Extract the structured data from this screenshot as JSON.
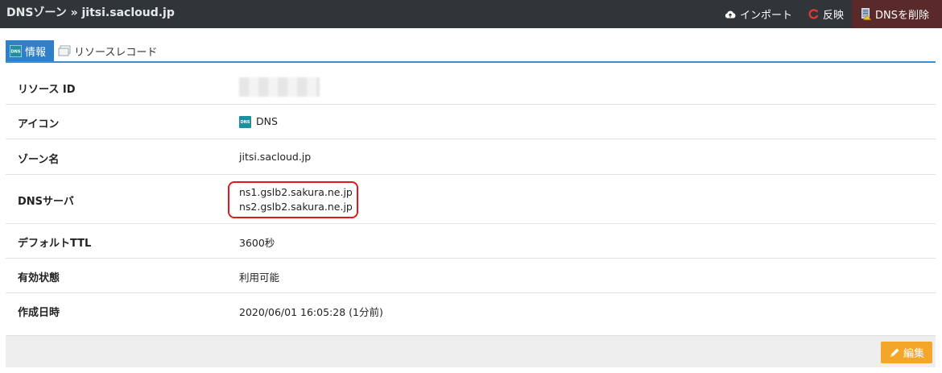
{
  "header": {
    "breadcrumb": "DNSゾーン » jitsi.sacloud.jp",
    "actions": {
      "import_label": "インポート",
      "apply_label": "反映",
      "delete_label": "DNSを削除"
    }
  },
  "tabs": [
    {
      "label": "情報",
      "active": true,
      "icon": "dns-icon"
    },
    {
      "label": "リソースレコード",
      "active": false,
      "icon": "records-icon"
    }
  ],
  "details": {
    "resource_id": {
      "label": "リソース ID",
      "value": ""
    },
    "icon": {
      "label": "アイコン",
      "value": "DNS",
      "icon_text": "DNS"
    },
    "zone_name": {
      "label": "ゾーン名",
      "value": "jitsi.sacloud.jp"
    },
    "dns_servers": {
      "label": "DNSサーバ",
      "values": [
        "ns1.gslb2.sakura.ne.jp",
        "ns2.gslb2.sakura.ne.jp"
      ]
    },
    "default_ttl": {
      "label": "デフォルトTTL",
      "value": "3600秒"
    },
    "status": {
      "label": "有効状態",
      "value": "利用可能"
    },
    "created_at": {
      "label": "作成日時",
      "value": "2020/06/01 16:05:28 (1分前)"
    }
  },
  "footer": {
    "edit_label": "編集"
  },
  "colors": {
    "topbar": "#30353a",
    "delete_bg": "#5a2a2a",
    "tab_active": "#2f7fc9",
    "highlight": "#e01a1a",
    "edit_button": "#f4a62a"
  }
}
